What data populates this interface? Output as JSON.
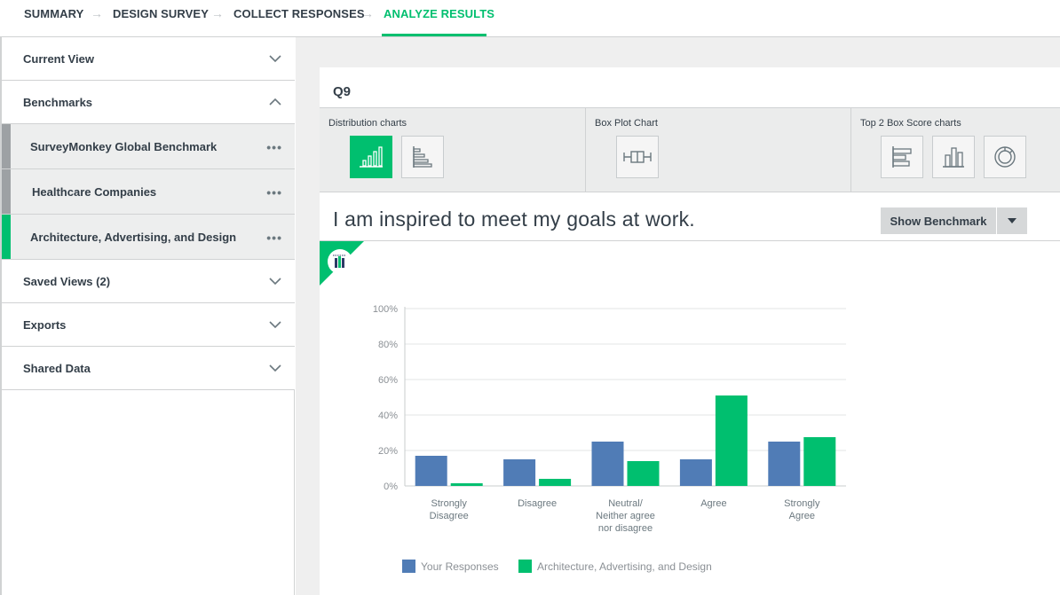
{
  "nav": {
    "steps": [
      "SUMMARY",
      "DESIGN SURVEY",
      "COLLECT RESPONSES",
      "ANALYZE RESULTS"
    ],
    "arrow": "→",
    "active_step": "ANALYZE RESULTS"
  },
  "sidebar": {
    "current_view": "Current View",
    "benchmarks": "Benchmarks",
    "benchmark_items": [
      "SurveyMonkey Global Benchmark",
      "Healthcare Companies",
      "Architecture, Advertising, and Design"
    ],
    "more": "•••",
    "saved_views": "Saved Views (2)",
    "exports": "Exports",
    "shared_data": "Shared Data"
  },
  "question": {
    "number": "Q9",
    "text": "I am inspired to meet my goals at work."
  },
  "chart_types": {
    "distribution": "Distribution charts",
    "boxplot": "Box Plot Chart",
    "top2": "Top 2 Box Score charts"
  },
  "benchmark_button": "Show Benchmark",
  "colors": {
    "accent": "#00bf6f",
    "series_blue": "#507cb6",
    "series_green": "#00bf6f"
  },
  "chart_data": {
    "type": "bar",
    "categories": [
      [
        "Strongly",
        "Disagree"
      ],
      [
        "Disagree"
      ],
      [
        "Neutral/",
        "Neither agree",
        "nor disagree"
      ],
      [
        "Agree"
      ],
      [
        "Strongly",
        "Agree"
      ]
    ],
    "series": [
      {
        "name": "Your Responses",
        "color": "#507cb6",
        "values": [
          17,
          15,
          25,
          15,
          25
        ]
      },
      {
        "name": "Architecture, Advertising, and Design",
        "color": "#00bf6f",
        "values": [
          1.5,
          4,
          14,
          51,
          27.5
        ]
      }
    ],
    "yticks": [
      "100%",
      "80%",
      "60%",
      "40%",
      "20%",
      "0%"
    ],
    "ylim": [
      0,
      100
    ],
    "grid": true,
    "legend": "bottom"
  }
}
